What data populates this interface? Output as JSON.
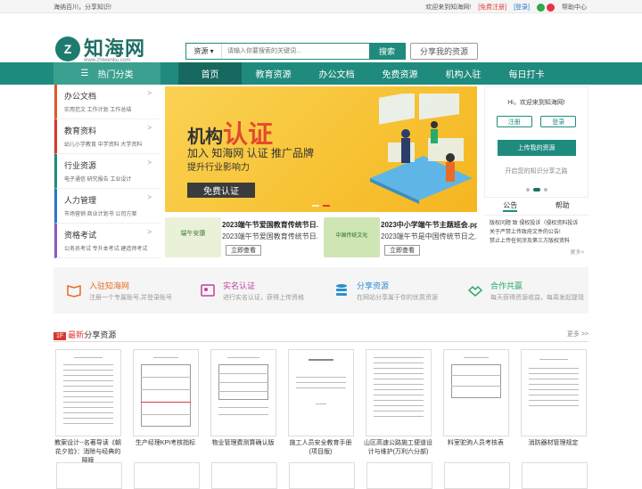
{
  "topbar": {
    "slogan": "海纳百川，分享知识!",
    "welcome": "欢迎来到知海网!",
    "register": "[免费注册]",
    "login": "[登录]",
    "help": "帮助中心",
    "wechat_color": "#2dab45",
    "weibo_color": "#e6324b"
  },
  "logo": {
    "mark": "Z",
    "name": "知海网",
    "url": "www.zhiwenku.com"
  },
  "search": {
    "category": "资源",
    "placeholder": "请输入你要搜索的关键词...",
    "button": "搜索"
  },
  "share_button": "分享我的资源",
  "nav": {
    "category_label": "热门分类",
    "items": [
      "首页",
      "教育资源",
      "办公文档",
      "免费资源",
      "机构入驻",
      "每日打卡"
    ]
  },
  "sidebar": [
    {
      "title": "办公文档",
      "subs": "实用范文  工作计划  工作总结",
      "color": "#e05a2b"
    },
    {
      "title": "教育资料",
      "subs": "幼儿小学教育  中学资料  大学资料",
      "color": "#d9372c"
    },
    {
      "title": "行业资源",
      "subs": "电子通信  研究报告  工业设计",
      "color": "#1f8b7e"
    },
    {
      "title": "人力管理",
      "subs": "市场营销  商业计划书  公司方案",
      "color": "#2a77c9"
    },
    {
      "title": "资格考试",
      "subs": "公务员考试  专升本考试  建造师考试",
      "color": "#8a5bbf"
    }
  ],
  "banner": {
    "title_a": "机构",
    "title_b": "认证",
    "line1": "加入 知海网 认证 推广品牌",
    "line2": "提升行业影响力",
    "button": "免费认证"
  },
  "user": {
    "greeting": "Hi，欢迎来到知海网!",
    "register": "注册",
    "login": "登录",
    "upload": "上传我的资源",
    "journey": "开启您的知识分享之路"
  },
  "notice": {
    "tabs": [
      "公告",
      "帮助"
    ],
    "lines": [
      "版权问题 致 侵权投诉（侵权资料投诉",
      "关于严禁上传政府文件的公告!",
      "禁止上传任何涉及第三方版权资料"
    ],
    "more": "更多>"
  },
  "news": [
    {
      "title": "2023端午节爱国教育传统节日...",
      "desc": "2023端午节爱国教育传统节日...",
      "button": "立即查看",
      "thumb_text": "端午安康"
    },
    {
      "title": "2023中小学端午节主题班会.ppt",
      "desc": "2023端午节是中国传统节日之...",
      "button": "立即查看",
      "thumb_text": "中国传统文化"
    }
  ],
  "features": [
    {
      "title": "入驻知海网",
      "desc": "注册一个专属账号,并登录账号",
      "color": "#e96b2a"
    },
    {
      "title": "实名认证",
      "desc": "进行实名认证，获得上传资格",
      "color": "#c0429a"
    },
    {
      "title": "分享资源",
      "desc": "在网站分享属于你的优质资源",
      "color": "#2a8fd1"
    },
    {
      "title": "合作共赢",
      "desc": "每天获得资源收益，每周发起提现",
      "color": "#2aaa68"
    }
  ],
  "section": {
    "tag": "1F",
    "title_a": "最新",
    "title_b": "分享资源",
    "more": "更多 >>"
  },
  "documents": [
    {
      "caption": "教案设计--名著导读《朝花夕拾》：消除与经典的隔膜"
    },
    {
      "caption": "生产经理KPI考核指标"
    },
    {
      "caption": "物业管理费测算确认版"
    },
    {
      "caption": "施工人员安全教育手册(项目版)"
    },
    {
      "caption": "山区高速公路施工便道设计与维护(万利六分部)"
    },
    {
      "caption": "料室驼驹人员考核表"
    },
    {
      "caption": "消防器材管理规定"
    }
  ]
}
